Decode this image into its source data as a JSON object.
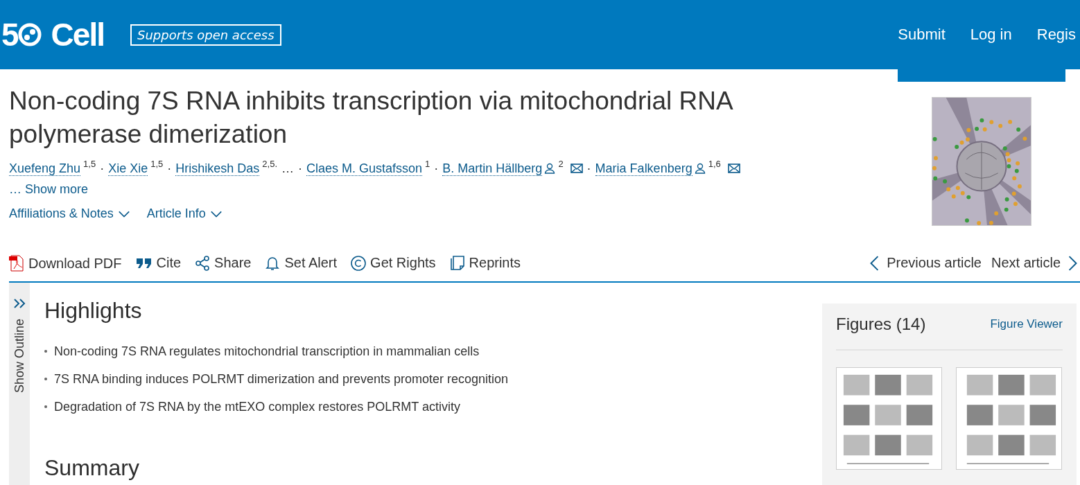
{
  "header": {
    "logo": {
      "number": "5",
      "name": "Cell"
    },
    "badge": "Supports open access",
    "nav": [
      "Submit",
      "Log in",
      "Regis"
    ]
  },
  "article": {
    "title": "Non-coding 7S RNA inhibits transcription via mitochondrial RNA polymerase dimerization",
    "authors": [
      {
        "kind": "author",
        "name": "Xuefeng Zhu",
        "sup": "1,5",
        "corresponding": false
      },
      {
        "kind": "author",
        "sep": "·",
        "name": "Xie Xie",
        "sup": "1,5",
        "corresponding": false
      },
      {
        "kind": "author",
        "sep": "·",
        "name": "Hrishikesh Das",
        "sup": "2,5.",
        "corresponding": false
      },
      {
        "kind": "ellipsis",
        "name": "…"
      },
      {
        "kind": "author",
        "sep": "·",
        "name": "Claes M. Gustafsson",
        "sup": "1",
        "corresponding": false
      },
      {
        "kind": "author",
        "sep": "·",
        "name": "B. Martin Hällberg",
        "sup": "2",
        "corresponding": true
      },
      {
        "kind": "author",
        "sep": "·",
        "name": "Maria Falkenberg",
        "sup": "1,6",
        "corresponding": true
      }
    ],
    "show_more": "… Show more",
    "dropdowns": [
      "Affiliations & Notes",
      "Article Info"
    ]
  },
  "toolbar": {
    "actions": [
      {
        "kind": "pdf",
        "label": "Download PDF"
      },
      {
        "kind": "cite",
        "label": "Cite"
      },
      {
        "kind": "share",
        "label": "Share"
      },
      {
        "kind": "alert",
        "label": "Set Alert"
      },
      {
        "kind": "rights",
        "label": "Get Rights"
      },
      {
        "kind": "reprints",
        "label": "Reprints"
      }
    ],
    "previous": "Previous article",
    "next": "Next article"
  },
  "outline": {
    "label": "Show Outline"
  },
  "highlights": {
    "heading": "Highlights",
    "items": [
      "Non-coding 7S RNA regulates mitochondrial transcription in mammalian cells",
      "7S RNA binding induces POLRMT dimerization and prevents promoter recognition",
      "Degradation of 7S RNA by the mtEXO complex restores POLRMT activity"
    ]
  },
  "summary": {
    "heading": "Summary"
  },
  "figures": {
    "title": "Figures (14)",
    "viewer": "Figure Viewer"
  }
}
